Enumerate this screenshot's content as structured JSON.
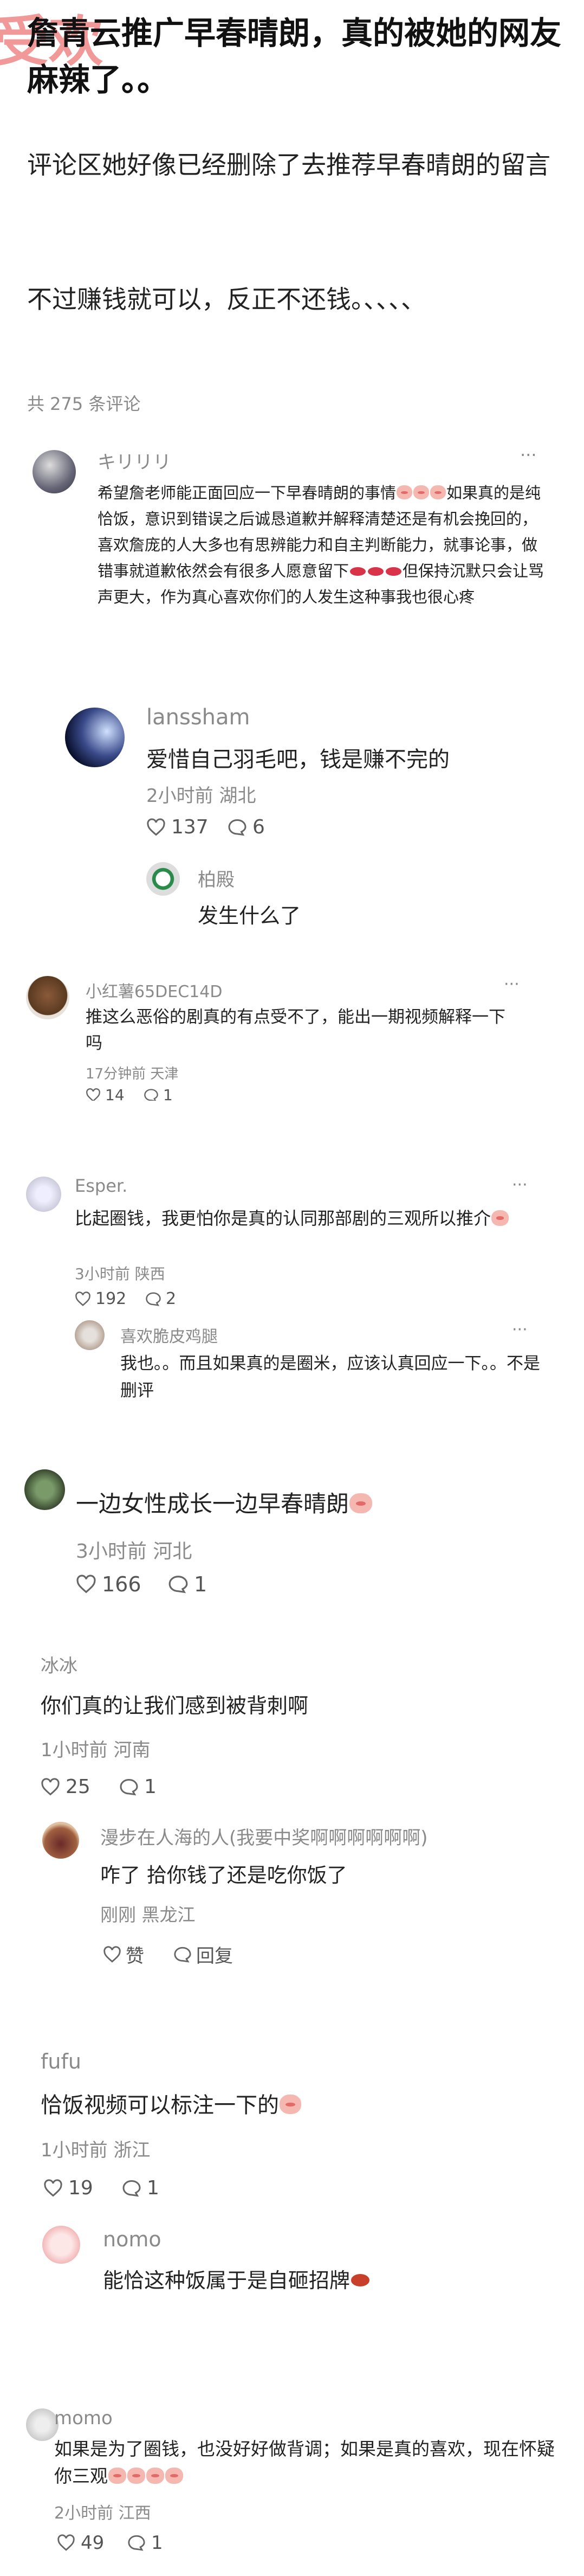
{
  "header": {
    "watermark": "受欢",
    "title": "詹青云推广早春晴朗，真的被她的网友麻辣了。。",
    "line1": "评论区她好像已经删除了去推荐早春晴朗的留言",
    "line2": "不过赚钱就可以，反正不还钱。、、、、",
    "comment_count": "共 275 条评论"
  },
  "comments": {
    "c1": {
      "name": "キリリリ",
      "text": "希望詹老师能正面回应一下早春晴朗的事情",
      "text2": "如果真的是纯恰饭，意识到错误之后诚恳道歉并解释清楚还是有机会挽回的，喜欢詹庞的人大多也有思辨能力和自主判断能力，就事论事，做错事就道歉依然会有很多人愿意留下",
      "text3": "但保持沉默只会让骂声更大，作为真心喜欢你们的人发生这种事我也很心疼"
    },
    "c2": {
      "name": "lanssham",
      "text": "爱惜自己羽毛吧，钱是赚不完的",
      "time": "2小时前 湖北",
      "likes": "137",
      "replies": "6",
      "reply": {
        "name": "柏殿",
        "text": "发生什么了"
      }
    },
    "c3": {
      "name": "小红薯65DEC14D",
      "text": "推这么恶俗的剧真的有点受不了，能出一期视频解释一下吗",
      "time": "17分钟前 天津",
      "likes": "14",
      "replies": "1"
    },
    "c4": {
      "name": "Esper.",
      "text": "比起圈钱，我更怕你是真的认同那部剧的三观所以推介",
      "time": "3小时前 陕西",
      "likes": "192",
      "replies": "2",
      "reply": {
        "name": "喜欢脆皮鸡腿",
        "text": "我也。。而且如果真的是圈米，应该认真回应一下。。不是删评"
      }
    },
    "c5": {
      "text": "一边女性成长一边早春晴朗",
      "time": "3小时前 河北",
      "likes": "166",
      "replies": "1"
    },
    "c6": {
      "name": "冰冰",
      "text": "你们真的让我们感到被背刺啊",
      "time": "1小时前 河南",
      "likes": "25",
      "replies": "1",
      "reply": {
        "name": "漫步在人海的人(我要中奖啊啊啊啊啊啊)",
        "text": "咋了 拾你钱了还是吃你饭了",
        "time": "刚刚 黑龙江",
        "like_label": "赞",
        "reply_label": "回复"
      }
    },
    "c7": {
      "name": "fufu",
      "text": "恰饭视频可以标注一下的",
      "time": "1小时前 浙江",
      "likes": "19",
      "replies": "1",
      "reply": {
        "name": "nomo",
        "text": "能恰这种饭属于是自砸招牌"
      }
    },
    "c8": {
      "name": "momo",
      "text": "如果是为了圈钱，也没好好做背调；如果是真的喜欢，现在怀疑你三观",
      "time": "2小时前 江西",
      "likes": "49",
      "replies": "1"
    }
  },
  "more_label": "···",
  "colors": {
    "text": "#222222",
    "meta": "#8a8a8a",
    "divider": "#f0f0f0"
  }
}
